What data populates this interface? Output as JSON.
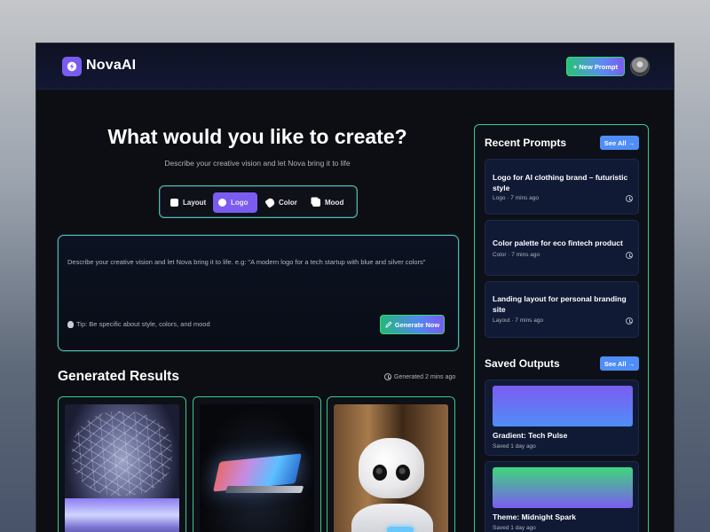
{
  "app": {
    "name": "NovaAI",
    "new_prompt_label": "+ New Prompt"
  },
  "hero": {
    "title": "What would you like to create?",
    "subtitle": "Describe your creative vision and let Nova bring it to life"
  },
  "type_tabs": [
    {
      "label": "Layout",
      "icon": "layout-icon",
      "active": false
    },
    {
      "label": "Logo",
      "icon": "logo-icon",
      "active": true
    },
    {
      "label": "Color",
      "icon": "eraser-icon",
      "active": false
    },
    {
      "label": "Mood",
      "icon": "copy-icon",
      "active": false
    }
  ],
  "prompt": {
    "placeholder": "Describe your creative vision and let Nova bring it to life. e.g: \"A modern logo for a tech startup with blue and silver colors\"",
    "tip": "Tip: Be specific about style, colors, and mood",
    "generate_label": "Generate Now"
  },
  "results": {
    "title": "Generated Results",
    "time": "Generated 2 mins ago",
    "items": [
      {
        "image": "neural-network-brain"
      },
      {
        "image": "glowing-laptop"
      },
      {
        "image": "white-robot"
      }
    ]
  },
  "recent_prompts": {
    "title": "Recent Prompts",
    "see_all_label": "See All →",
    "items": [
      {
        "title": "Logo for AI clothing brand – futuristic style",
        "meta": "Logo · 7 mins ago"
      },
      {
        "title": "Color palette for eco fintech product",
        "meta": "Color · 7 mins ago"
      },
      {
        "title": "Landing layout for personal branding site",
        "meta": "Layout · 7 mins ago"
      }
    ]
  },
  "saved_outputs": {
    "title": "Saved Outputs",
    "see_all_label": "See All →",
    "items": [
      {
        "title": "Gradient: Tech Pulse",
        "meta": "Saved 1 day ago",
        "colors": [
          "#7b5cf0",
          "#4f8ef7"
        ]
      },
      {
        "title": "Theme: Midnight Spark",
        "meta": "Saved 1 day ago",
        "colors": [
          "#3fd67c",
          "#7b5cf0"
        ]
      }
    ]
  },
  "colors": {
    "accent_purple": "#7b5cf0",
    "accent_green": "#3cc98b",
    "accent_blue": "#4f8ef7",
    "background": "#0c0e13"
  }
}
